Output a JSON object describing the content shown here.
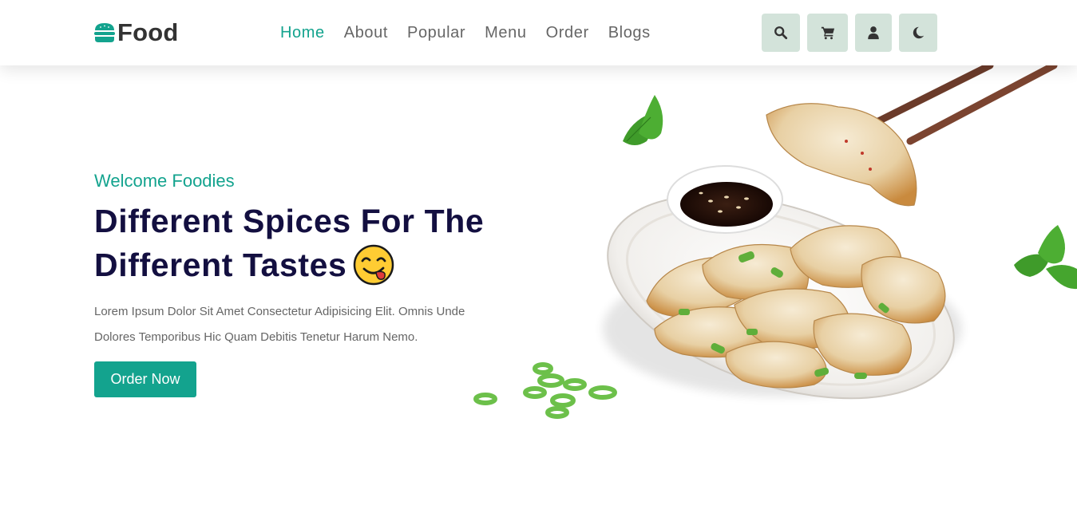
{
  "brand": {
    "name": "Food",
    "accent_color": "#13a38e",
    "icon": "burger-icon"
  },
  "nav": {
    "items": [
      {
        "label": "Home",
        "active": true
      },
      {
        "label": "About",
        "active": false
      },
      {
        "label": "Popular",
        "active": false
      },
      {
        "label": "Menu",
        "active": false
      },
      {
        "label": "Order",
        "active": false
      },
      {
        "label": "Blogs",
        "active": false
      }
    ]
  },
  "header_icons": [
    "search-icon",
    "cart-icon",
    "user-icon",
    "moon-icon"
  ],
  "hero": {
    "subtitle": "Welcome Foodies",
    "title": "Different Spices For The Different Tastes",
    "emoji": "yum-face-emoji",
    "description": "Lorem Ipsum Dolor Sit Amet Consectetur Adipisicing Elit. Omnis Unde Dolores Temporibus Hic Quam Debitis Tenetur Harum Nemo.",
    "button_label": "Order Now",
    "title_color": "#130f40"
  }
}
